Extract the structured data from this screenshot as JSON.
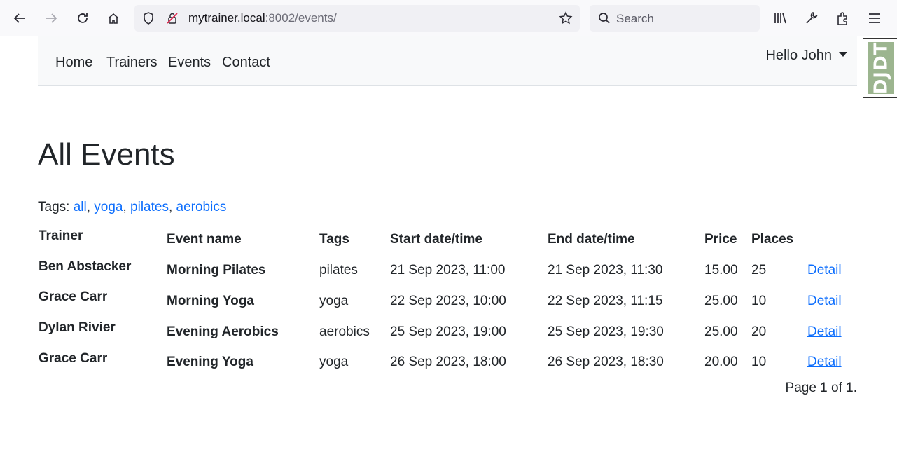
{
  "browser": {
    "url_host": "mytrainer.local",
    "url_rest": ":8002/events/",
    "search_placeholder": "Search"
  },
  "nav": {
    "links": [
      "Home",
      "Trainers",
      "Events",
      "Contact"
    ],
    "user_greeting": "Hello John"
  },
  "debug_toolbar": {
    "label": "DJDT"
  },
  "page": {
    "title": "All Events",
    "tags_label": "Tags:",
    "tags": [
      "all",
      "yoga",
      "pilates",
      "aerobics"
    ]
  },
  "table": {
    "headers": [
      "Trainer",
      "Event name",
      "Tags",
      "Start date/time",
      "End date/time",
      "Price",
      "Places"
    ],
    "rows": [
      {
        "trainer": "Ben Abstacker",
        "event": "Morning Pilates",
        "tags": "pilates",
        "start": "21 Sep 2023, 11:00",
        "end": "21 Sep 2023, 11:30",
        "price": "15.00",
        "places": "25",
        "detail": "Detail"
      },
      {
        "trainer": "Grace Carr",
        "event": "Morning Yoga",
        "tags": "yoga",
        "start": "22 Sep 2023, 10:00",
        "end": "22 Sep 2023, 11:15",
        "price": "25.00",
        "places": "10",
        "detail": "Detail"
      },
      {
        "trainer": "Dylan Rivier",
        "event": "Evening Aerobics",
        "tags": "aerobics",
        "start": "25 Sep 2023, 19:00",
        "end": "25 Sep 2023, 19:30",
        "price": "25.00",
        "places": "20",
        "detail": "Detail"
      },
      {
        "trainer": "Grace Carr",
        "event": "Evening Yoga",
        "tags": "yoga",
        "start": "26 Sep 2023, 18:00",
        "end": "26 Sep 2023, 18:30",
        "price": "20.00",
        "places": "10",
        "detail": "Detail"
      }
    ]
  },
  "pagination": {
    "text": "Page 1 of 1."
  },
  "colors": {
    "link": "#0d6efd",
    "text": "#212529",
    "nav_bg": "#f8f9fa",
    "djdt": "#9cb58f"
  }
}
